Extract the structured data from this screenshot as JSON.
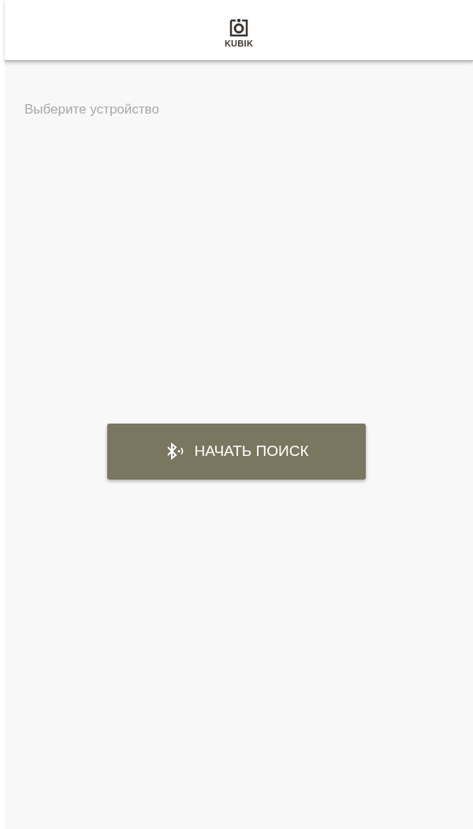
{
  "header": {
    "logo_text": "KUBIK"
  },
  "prompt": "Выберите устройство",
  "search_button": {
    "label": "НАЧАТЬ ПОИСК"
  }
}
